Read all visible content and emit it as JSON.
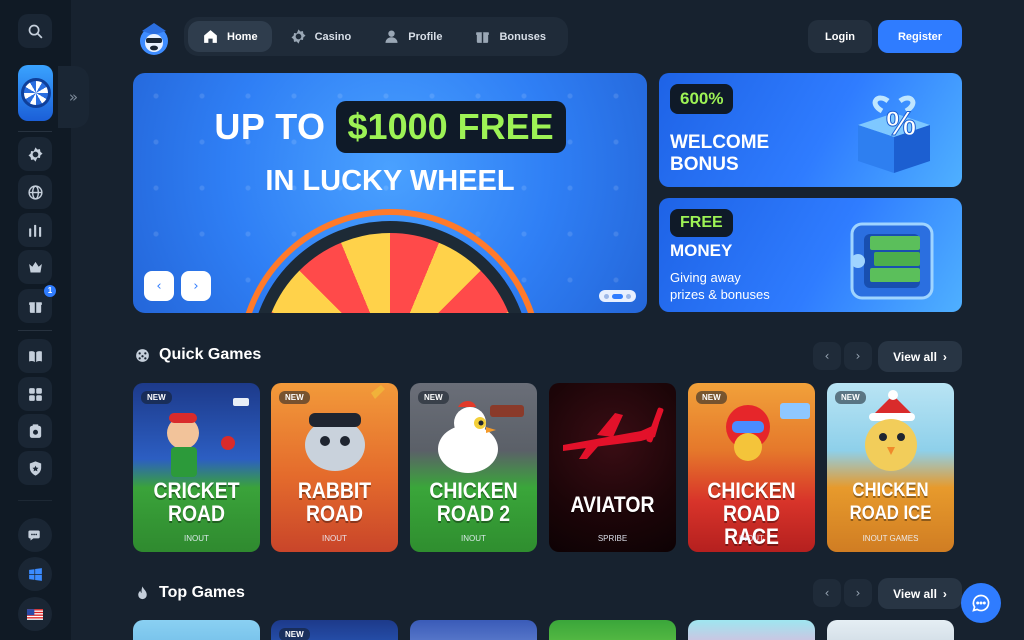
{
  "app": {
    "title": "Casino"
  },
  "sidebar": {
    "icons": [
      "search-icon",
      "lucky-wheel-icon",
      "expand-icon",
      "casino-chip-icon",
      "globe-icon",
      "sports-icon",
      "crown-icon",
      "gift-icon",
      "book-icon",
      "puzzle-icon",
      "vault-icon",
      "shield-icon",
      "chat-bubbles-icon",
      "windows-icon",
      "us-flag-icon"
    ],
    "gift_badge": "1"
  },
  "nav": {
    "items": [
      {
        "label": "Home",
        "icon": "home-icon",
        "active": true
      },
      {
        "label": "Casino",
        "icon": "chip-icon",
        "active": false
      },
      {
        "label": "Profile",
        "icon": "user-icon",
        "active": false
      },
      {
        "label": "Bonuses",
        "icon": "gift-icon",
        "active": false
      }
    ]
  },
  "auth": {
    "login": "Login",
    "register": "Register"
  },
  "hero": {
    "line1_a": "UP TO",
    "line1_b": "$1000 FREE",
    "line2": "IN LUCKY WHEEL",
    "prev": "‹",
    "next": "›"
  },
  "promos": [
    {
      "pill": "600%",
      "title_a": "WELCOME",
      "title_b": "BONUS"
    },
    {
      "pill": "FREE",
      "title": "MONEY",
      "sub_a": "Giving away",
      "sub_b": "prizes & bonuses"
    }
  ],
  "sections": {
    "quick": {
      "title": "Quick Games",
      "view_all": "View all"
    },
    "top": {
      "title": "Top Games",
      "view_all": "View all"
    }
  },
  "quick_games": [
    {
      "name_a": "CRICKET",
      "name_b": "ROAD",
      "provider": "INOUT",
      "new": "NEW"
    },
    {
      "name_a": "RABBIT",
      "name_b": "ROAD",
      "provider": "INOUT",
      "new": "NEW"
    },
    {
      "name_a": "CHICKEN",
      "name_b": "ROAD 2",
      "provider": "INOUT",
      "new": "NEW"
    },
    {
      "name_a": "AVIATOR",
      "name_b": "",
      "provider": "SPRIBE",
      "new": ""
    },
    {
      "name_a": "CHICKEN",
      "name_b": "ROAD RACE",
      "provider": "INOUT",
      "new": "NEW"
    },
    {
      "name_a": "CHICKEN",
      "name_b": "ROAD ICE",
      "provider": "INOUT GAMES",
      "new": "NEW"
    }
  ],
  "top_games_new": "NEW",
  "colors": {
    "accent": "#2f7cff",
    "lime": "#9df255",
    "bg": "#17222f",
    "sidebar": "#101a25"
  }
}
